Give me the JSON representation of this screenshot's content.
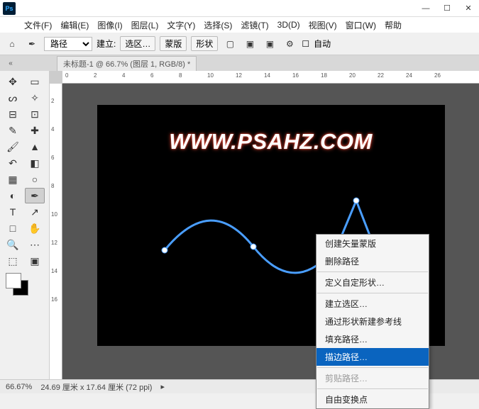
{
  "window": {
    "app_abbr": "Ps",
    "min": "—",
    "max": "☐",
    "close": "✕"
  },
  "menubar": {
    "file": "文件(F)",
    "edit": "编辑(E)",
    "image": "图像(I)",
    "layer": "图层(L)",
    "type": "文字(Y)",
    "select": "选择(S)",
    "filter": "滤镜(T)",
    "3d": "3D(D)",
    "view": "视图(V)",
    "window": "窗口(W)",
    "help": "帮助"
  },
  "options": {
    "home_icon": "⌂",
    "pen_icon": "✒",
    "mode_label_sel": "路径",
    "create_label": "建立:",
    "btn_selection": "选区…",
    "btn_mask": "蒙版",
    "btn_shape": "形状",
    "align_icon": "▢",
    "bool_icon": "▣",
    "gear_icon": "⚙",
    "auto_label": "自动",
    "checkbox": "☐"
  },
  "tabs": {
    "collapse": "«",
    "doc_title": "未标题-1 @ 66.7% (图层 1, RGB/8) *"
  },
  "ruler_h": [
    "0",
    "2",
    "4",
    "6",
    "8",
    "10",
    "12",
    "14",
    "16",
    "18",
    "20",
    "22",
    "24",
    "26"
  ],
  "ruler_v": [
    "2",
    "4",
    "6",
    "8",
    "10",
    "12",
    "14",
    "16"
  ],
  "canvas": {
    "watermark": "WWW.PSAHZ.COM"
  },
  "context_menu": {
    "create_vector_mask": "创建矢量蒙版",
    "delete_path": "删除路径",
    "define_shape": "定义自定形状…",
    "make_selection": "建立选区…",
    "new_guide_from_shape": "通过形状新建参考线",
    "fill_path": "填充路径…",
    "stroke_path": "描边路径…",
    "clip_path": "剪贴路径…",
    "free_transform_points": "自由变换点"
  },
  "status": {
    "zoom": "66.67%",
    "dimensions": "24.69 厘米 x 17.64 厘米 (72 ppi)",
    "arrow": "▸"
  },
  "tools": {
    "move": "✥",
    "marquee": "▭",
    "lasso": "ᔕ",
    "wand": "✧",
    "crop": "⊟",
    "frame": "⊡",
    "eyedrop": "✎",
    "heal": "✚",
    "brush": "🖌",
    "stamp": "▲",
    "history": "↶",
    "eraser": "◧",
    "gradient": "▦",
    "blur": "○",
    "dodge": "◐",
    "pen": "✒",
    "type": "T",
    "path": "↗",
    "rect": "□",
    "hand": "✋",
    "zoom": "🔍",
    "more": "⋯",
    "edit": "⬚",
    "mask": "▣"
  }
}
